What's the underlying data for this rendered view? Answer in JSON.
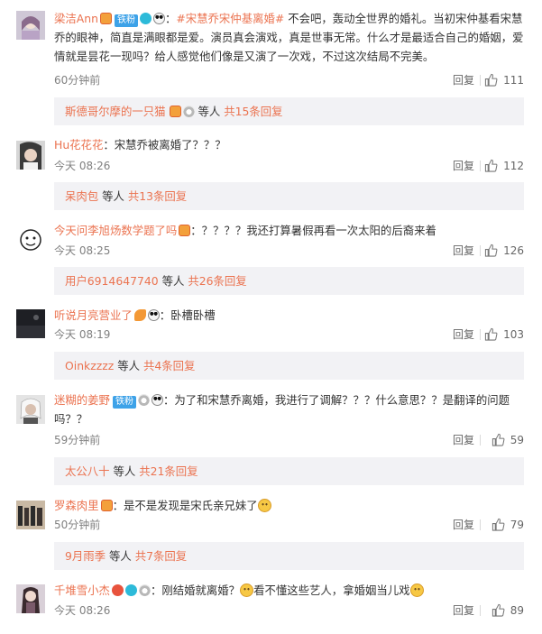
{
  "comments": [
    {
      "avatar": "avatar-girl",
      "username": "梁洁Ann",
      "badges": [
        "red-diamond-badge",
        "fan-badge",
        "cyan-badge",
        "panda-badge"
      ],
      "fan_label": "铁粉",
      "topic": "#宋慧乔宋仲基离婚#",
      "text": " 不会吧，轰动全世界的婚礼。当初宋仲基看宋慧乔的眼神，简直是满眼都是爱。演员真会演戏，真是世事无常。什么才是最适合自己的婚姻，爱情就是昙花一现吗？给人感觉他们像是又演了一次戏，不过这次结局不完美。",
      "time": "60分钟前",
      "reply": "回复",
      "likes": "111",
      "sub": {
        "user": "斯德哥尔摩的一只猫",
        "rest_label": "等人",
        "count_label": "共15条回复"
      }
    },
    {
      "avatar": "avatar-dark-girl",
      "username": "Hu花花花",
      "badges": [],
      "text": "：宋慧乔被离婚了？？？",
      "time": "今天 08:26",
      "reply": "回复",
      "likes": "112",
      "sub": {
        "user": "呆肉包",
        "rest_label": "等人",
        "count_label": "共13条回复"
      }
    },
    {
      "avatar": "avatar-sketch",
      "username": "今天问李旭炀数学题了吗",
      "badges": [
        "red-diamond-badge"
      ],
      "text": "：？？？？我还打算暑假再看一次太阳的后裔来着",
      "time": "今天 08:25",
      "reply": "回复",
      "likes": "126",
      "sub": {
        "user": "用户6914647740",
        "rest_label": "等人",
        "count_label": "共26条回复"
      }
    },
    {
      "avatar": "avatar-night",
      "username": "听说月亮营业了",
      "badges": [
        "flower-badge",
        "panda-badge"
      ],
      "text": "：卧槽卧槽",
      "time": "今天 08:19",
      "reply": "回复",
      "likes": "103",
      "sub": {
        "user": "Oinkzzzz",
        "rest_label": "等人",
        "count_label": "共4条回复"
      }
    },
    {
      "avatar": "avatar-white-hair",
      "username": "迷糊的姜野",
      "badges": [
        "fan-badge",
        "silver-badge",
        "panda-badge"
      ],
      "fan_label": "铁粉",
      "text": "：为了和宋慧乔离婚，我进行了调解？？？什么意思？？是翻译的问题吗？？",
      "time": "59分钟前",
      "reply": "回复",
      "likes": "59",
      "sub": {
        "user": "太公八十",
        "rest_label": "等人",
        "count_label": "共21条回复"
      }
    },
    {
      "avatar": "avatar-group",
      "username": "罗森肉里",
      "badges": [
        "red-diamond-badge"
      ],
      "text": "：是不是发现是宋氏亲兄妹了",
      "time": "50分钟前",
      "reply": "回复",
      "likes": "79",
      "sub": {
        "user": "9月雨季",
        "rest_label": "等人",
        "count_label": "共7条回复"
      }
    },
    {
      "avatar": "avatar-long-hair",
      "username": "千堆雪小杰",
      "badges": [
        "ribbon-badge",
        "cyan-badge",
        "silver-badge"
      ],
      "text": "：刚结婚就离婚？",
      "text2": "看不懂这些艺人，拿婚姻当儿戏",
      "time": "今天 08:26",
      "reply": "回复",
      "likes": "89"
    }
  ]
}
